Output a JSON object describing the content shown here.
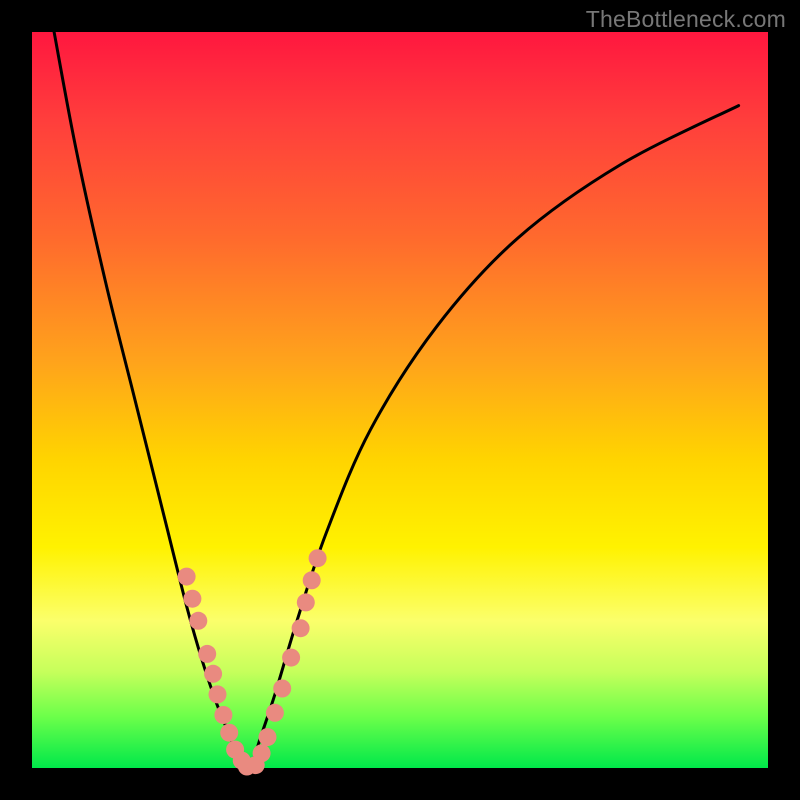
{
  "watermark": "TheBottleneck.com",
  "chart_data": {
    "type": "line",
    "title": "",
    "xlabel": "",
    "ylabel": "",
    "xlim": [
      0,
      100
    ],
    "ylim": [
      0,
      100
    ],
    "background_gradient": {
      "top_color": "#ff173f",
      "bottom_color": "#00e84a",
      "meaning": "vertical heat gradient, red high value, green low value"
    },
    "series": [
      {
        "name": "bottleneck-curve",
        "x": [
          3,
          6,
          10,
          14,
          17,
          19,
          21,
          23,
          25,
          27,
          28,
          29,
          30,
          31,
          33,
          36,
          40,
          46,
          55,
          66,
          80,
          96
        ],
        "y": [
          100,
          84,
          66,
          50,
          38,
          30,
          22,
          15,
          9,
          4,
          1,
          0,
          1,
          4,
          10,
          20,
          32,
          46,
          60,
          72,
          82,
          90
        ],
        "color": "#000000",
        "stroke_width": 2
      }
    ],
    "scatter_clusters": [
      {
        "name": "left-branch-dots",
        "color": "#e98a80",
        "points": [
          {
            "x": 21.0,
            "y": 26.0
          },
          {
            "x": 21.8,
            "y": 23.0
          },
          {
            "x": 22.6,
            "y": 20.0
          },
          {
            "x": 23.8,
            "y": 15.5
          },
          {
            "x": 24.6,
            "y": 12.8
          },
          {
            "x": 25.2,
            "y": 10.0
          },
          {
            "x": 26.0,
            "y": 7.2
          },
          {
            "x": 26.8,
            "y": 4.8
          },
          {
            "x": 27.6,
            "y": 2.5
          },
          {
            "x": 28.5,
            "y": 1.0
          },
          {
            "x": 29.2,
            "y": 0.2
          }
        ]
      },
      {
        "name": "right-branch-dots",
        "color": "#e98a80",
        "points": [
          {
            "x": 30.4,
            "y": 0.4
          },
          {
            "x": 31.2,
            "y": 2.0
          },
          {
            "x": 32.0,
            "y": 4.2
          },
          {
            "x": 33.0,
            "y": 7.5
          },
          {
            "x": 34.0,
            "y": 10.8
          },
          {
            "x": 35.2,
            "y": 15.0
          },
          {
            "x": 36.5,
            "y": 19.0
          },
          {
            "x": 37.2,
            "y": 22.5
          },
          {
            "x": 38.0,
            "y": 25.5
          },
          {
            "x": 38.8,
            "y": 28.5
          }
        ]
      }
    ],
    "colors": {
      "curve": "#000000",
      "dots": "#e98a80",
      "frame": "#000000"
    }
  }
}
